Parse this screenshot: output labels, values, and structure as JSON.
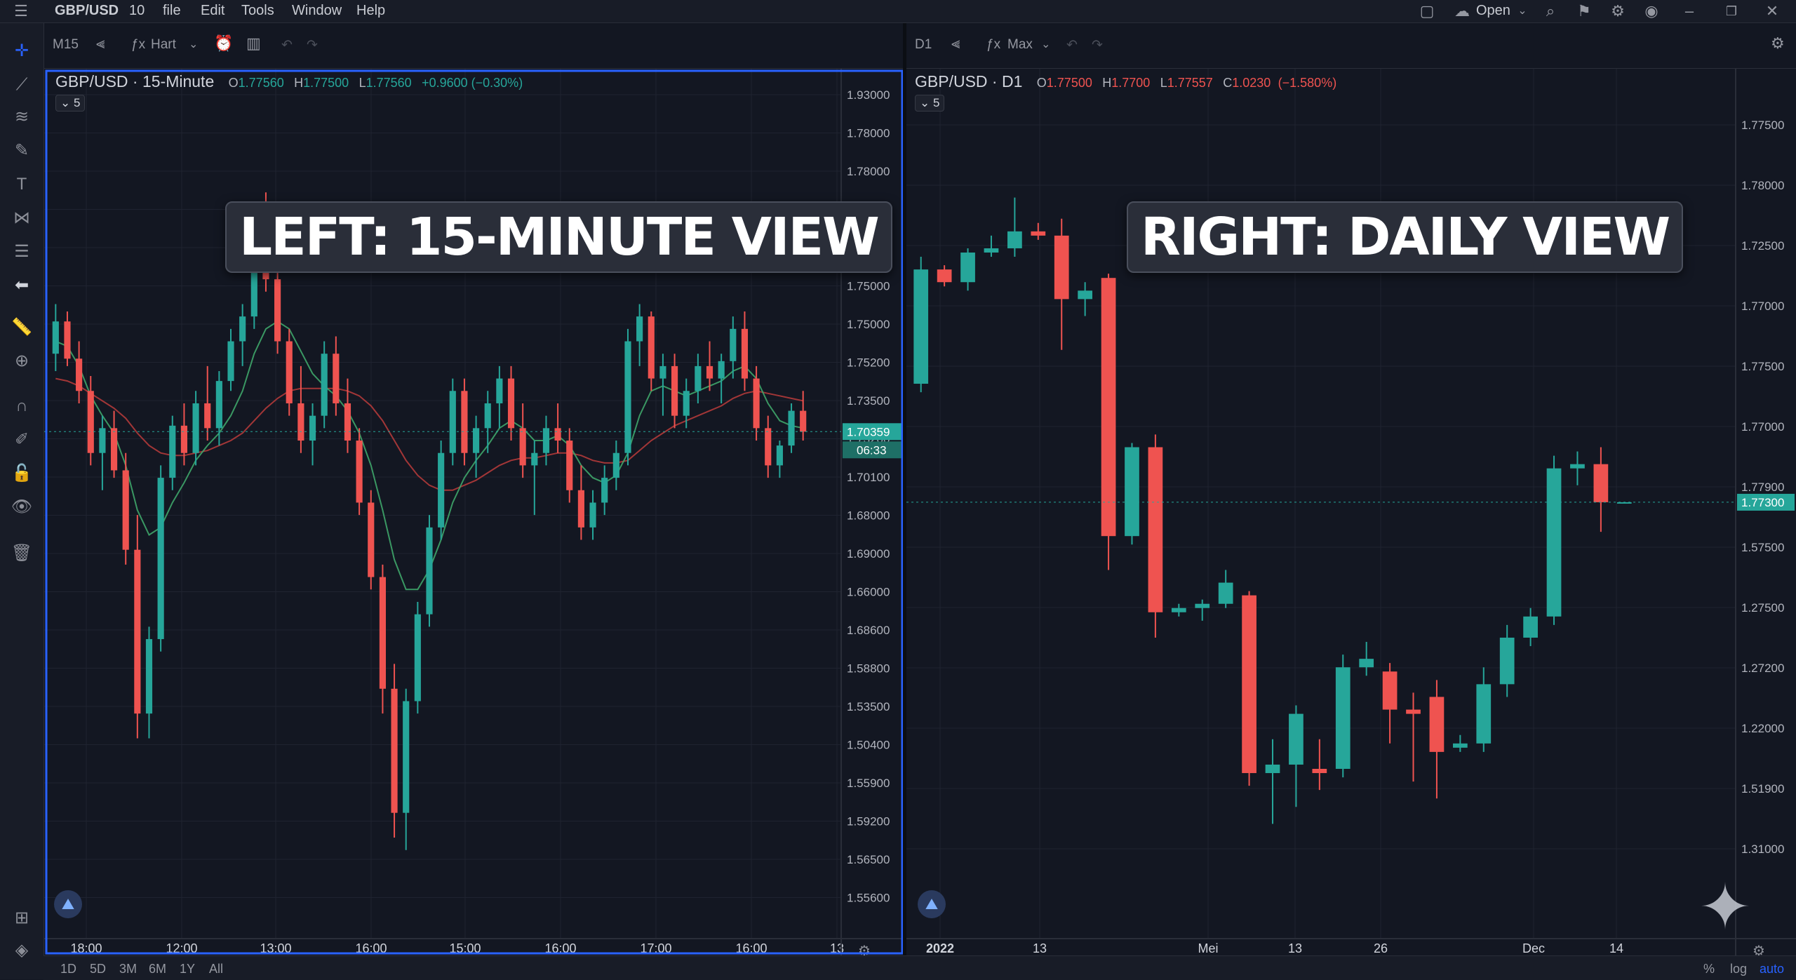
{
  "topbar": {
    "symbol": "GBP/USD",
    "interval": "10",
    "menu": [
      "file",
      "Edit",
      "Tools",
      "Window",
      "Help"
    ],
    "open_label": "Open"
  },
  "left_pane": {
    "interval_label": "M15",
    "indicator_label": "Hart",
    "legend": {
      "title": "GBP/USD · 15-Minute",
      "o": "1.77560",
      "h": "1.77500",
      "l": "1.77560",
      "change": "+0.9600 (−0.30%)"
    },
    "indicator_count": "5",
    "overlay": "LEFT: 15-MINUTE VIEW",
    "price_tag": "1.70359",
    "countdown": "06:33",
    "x_labels": [
      "18:00",
      "12:00",
      "13:00",
      "16:00",
      "15:00",
      "16:00",
      "17:00",
      "16:00",
      "13"
    ]
  },
  "right_pane": {
    "interval_label": "D1",
    "indicator_label": "Max",
    "legend": {
      "title": "GBP/USD · D1",
      "o": "1.77500",
      "h": "1.7700",
      "l": "1.77557",
      "c": "1.0230",
      "change": "(−1.580%)"
    },
    "indicator_count": "5",
    "overlay": "RIGHT: DAILY VIEW",
    "price_tag": "1.77300",
    "x_labels": [
      "2022",
      "13",
      "Mei",
      "13",
      "26",
      "Dec",
      "14"
    ]
  },
  "bottom": {
    "ranges": [
      "1D",
      "5D",
      "3M",
      "6M",
      "1Y",
      "All"
    ],
    "percent": "%",
    "log": "log",
    "auto": "auto"
  },
  "chart_data": [
    {
      "type": "candlestick",
      "title": "GBP/USD · 15-Minute",
      "y_tick_labels": [
        "1.93000",
        "1.78000",
        "1.78000",
        "1.77000",
        "1.76000",
        "1.75000",
        "1.75000",
        "1.75200",
        "1.73500",
        "1.73200",
        "1.70100",
        "1.68000",
        "1.69000",
        "1.66000",
        "1.68600",
        "1.58800",
        "1.53500",
        "1.50400",
        "1.55900",
        "1.59200",
        "1.56500",
        "1.55600"
      ],
      "x_tick_labels": [
        "18:00",
        "12:00",
        "13:00",
        "16:00",
        "15:00",
        "16:00",
        "17:00",
        "16:00",
        "13"
      ],
      "last_price": "1.70359",
      "colors": {
        "up": "#26a69a",
        "down": "#ef5350",
        "ma_fast": "#3fa66a",
        "ma_slow": "#b23a3a"
      },
      "candles": [
        [
          1.735,
          1.755,
          1.728,
          1.748
        ],
        [
          1.748,
          1.752,
          1.73,
          1.733
        ],
        [
          1.733,
          1.74,
          1.715,
          1.72
        ],
        [
          1.72,
          1.726,
          1.69,
          1.695
        ],
        [
          1.695,
          1.71,
          1.68,
          1.705
        ],
        [
          1.705,
          1.712,
          1.685,
          1.688
        ],
        [
          1.688,
          1.695,
          1.65,
          1.656
        ],
        [
          1.656,
          1.67,
          1.58,
          1.59
        ],
        [
          1.59,
          1.625,
          1.58,
          1.62
        ],
        [
          1.62,
          1.69,
          1.615,
          1.685
        ],
        [
          1.685,
          1.71,
          1.68,
          1.706
        ],
        [
          1.706,
          1.715,
          1.69,
          1.695
        ],
        [
          1.695,
          1.72,
          1.69,
          1.715
        ],
        [
          1.715,
          1.73,
          1.7,
          1.705
        ],
        [
          1.705,
          1.728,
          1.698,
          1.724
        ],
        [
          1.724,
          1.745,
          1.72,
          1.74
        ],
        [
          1.74,
          1.755,
          1.73,
          1.75
        ],
        [
          1.75,
          1.795,
          1.745,
          1.79
        ],
        [
          1.79,
          1.8,
          1.76,
          1.765
        ],
        [
          1.765,
          1.77,
          1.735,
          1.74
        ],
        [
          1.74,
          1.745,
          1.71,
          1.715
        ],
        [
          1.715,
          1.73,
          1.695,
          1.7
        ],
        [
          1.7,
          1.715,
          1.69,
          1.71
        ],
        [
          1.71,
          1.74,
          1.705,
          1.735
        ],
        [
          1.735,
          1.742,
          1.71,
          1.715
        ],
        [
          1.715,
          1.725,
          1.695,
          1.7
        ],
        [
          1.7,
          1.705,
          1.67,
          1.675
        ],
        [
          1.675,
          1.68,
          1.64,
          1.645
        ],
        [
          1.645,
          1.65,
          1.59,
          1.6
        ],
        [
          1.6,
          1.61,
          1.54,
          1.55
        ],
        [
          1.55,
          1.6,
          1.535,
          1.595
        ],
        [
          1.595,
          1.635,
          1.59,
          1.63
        ],
        [
          1.63,
          1.67,
          1.625,
          1.665
        ],
        [
          1.665,
          1.7,
          1.66,
          1.695
        ],
        [
          1.695,
          1.725,
          1.69,
          1.72
        ],
        [
          1.72,
          1.725,
          1.69,
          1.695
        ],
        [
          1.695,
          1.71,
          1.685,
          1.705
        ],
        [
          1.705,
          1.72,
          1.695,
          1.715
        ],
        [
          1.715,
          1.73,
          1.705,
          1.725
        ],
        [
          1.725,
          1.73,
          1.7,
          1.705
        ],
        [
          1.705,
          1.715,
          1.685,
          1.69
        ],
        [
          1.69,
          1.7,
          1.67,
          1.695
        ],
        [
          1.695,
          1.71,
          1.69,
          1.705
        ],
        [
          1.705,
          1.715,
          1.695,
          1.7
        ],
        [
          1.7,
          1.705,
          1.675,
          1.68
        ],
        [
          1.68,
          1.69,
          1.66,
          1.665
        ],
        [
          1.665,
          1.68,
          1.66,
          1.675
        ],
        [
          1.675,
          1.69,
          1.67,
          1.685
        ],
        [
          1.685,
          1.7,
          1.68,
          1.695
        ],
        [
          1.695,
          1.745,
          1.69,
          1.74
        ],
        [
          1.74,
          1.755,
          1.73,
          1.75
        ],
        [
          1.75,
          1.752,
          1.72,
          1.725
        ],
        [
          1.725,
          1.735,
          1.71,
          1.73
        ],
        [
          1.73,
          1.735,
          1.705,
          1.71
        ],
        [
          1.71,
          1.725,
          1.705,
          1.72
        ],
        [
          1.72,
          1.735,
          1.715,
          1.73
        ],
        [
          1.73,
          1.74,
          1.72,
          1.725
        ],
        [
          1.725,
          1.735,
          1.715,
          1.732
        ],
        [
          1.732,
          1.75,
          1.725,
          1.745
        ],
        [
          1.745,
          1.752,
          1.72,
          1.725
        ],
        [
          1.725,
          1.73,
          1.7,
          1.705
        ],
        [
          1.705,
          1.71,
          1.685,
          1.69
        ],
        [
          1.69,
          1.7,
          1.685,
          1.698
        ],
        [
          1.698,
          1.715,
          1.695,
          1.712
        ],
        [
          1.712,
          1.72,
          1.7,
          1.7036
        ]
      ],
      "ma_fast": [
        1.74,
        1.738,
        1.73,
        1.718,
        1.71,
        1.703,
        1.69,
        1.672,
        1.662,
        1.665,
        1.675,
        1.683,
        1.692,
        1.698,
        1.703,
        1.71,
        1.72,
        1.735,
        1.745,
        1.748,
        1.745,
        1.736,
        1.727,
        1.722,
        1.718,
        1.712,
        1.703,
        1.69,
        1.672,
        1.652,
        1.64,
        1.64,
        1.648,
        1.66,
        1.675,
        1.685,
        1.692,
        1.698,
        1.705,
        1.708,
        1.705,
        1.7,
        1.7,
        1.702,
        1.698,
        1.69,
        1.685,
        1.683,
        1.686,
        1.695,
        1.71,
        1.72,
        1.722,
        1.72,
        1.718,
        1.72,
        1.722,
        1.724,
        1.728,
        1.73,
        1.725,
        1.715,
        1.708,
        1.706,
        1.705
      ],
      "ma_slow": [
        1.725,
        1.724,
        1.722,
        1.719,
        1.716,
        1.713,
        1.709,
        1.703,
        1.698,
        1.695,
        1.694,
        1.694,
        1.695,
        1.696,
        1.698,
        1.7,
        1.703,
        1.708,
        1.713,
        1.717,
        1.72,
        1.721,
        1.721,
        1.721,
        1.721,
        1.72,
        1.718,
        1.714,
        1.708,
        1.7,
        1.692,
        1.686,
        1.682,
        1.68,
        1.68,
        1.682,
        1.684,
        1.687,
        1.69,
        1.692,
        1.693,
        1.693,
        1.694,
        1.695,
        1.695,
        1.694,
        1.692,
        1.691,
        1.691,
        1.692,
        1.696,
        1.7,
        1.703,
        1.706,
        1.708,
        1.71,
        1.712,
        1.714,
        1.717,
        1.719,
        1.72,
        1.719,
        1.718,
        1.717,
        1.716
      ]
    },
    {
      "type": "candlestick",
      "title": "GBP/USD · D1",
      "y_tick_labels": [
        "1.77500",
        "1.78000",
        "1.72500",
        "1.77000",
        "1.77500",
        "1.77000",
        "1.77900",
        "1.57500",
        "1.27500",
        "1.27200",
        "1.22000",
        "1.51900",
        "1.31000"
      ],
      "x_tick_labels": [
        "2022",
        "13",
        "Mei",
        "13",
        "26",
        "Dec",
        "14"
      ],
      "last_price": "1.77300",
      "colors": {
        "up": "#26a69a",
        "down": "#ef5350"
      },
      "candles": [
        [
          1.64,
          1.79,
          1.63,
          1.775
        ],
        [
          1.775,
          1.78,
          1.755,
          1.76
        ],
        [
          1.76,
          1.8,
          1.75,
          1.795
        ],
        [
          1.795,
          1.815,
          1.79,
          1.8
        ],
        [
          1.8,
          1.86,
          1.79,
          1.82
        ],
        [
          1.82,
          1.83,
          1.81,
          1.815
        ],
        [
          1.815,
          1.835,
          1.68,
          1.74
        ],
        [
          1.74,
          1.76,
          1.72,
          1.75
        ],
        [
          1.765,
          1.77,
          1.42,
          1.46
        ],
        [
          1.46,
          1.57,
          1.45,
          1.565
        ],
        [
          1.565,
          1.58,
          1.34,
          1.37
        ],
        [
          1.37,
          1.38,
          1.365,
          1.375
        ],
        [
          1.375,
          1.385,
          1.36,
          1.38
        ],
        [
          1.38,
          1.42,
          1.375,
          1.405
        ],
        [
          1.39,
          1.395,
          1.165,
          1.18
        ],
        [
          1.18,
          1.22,
          1.12,
          1.19
        ],
        [
          1.19,
          1.26,
          1.14,
          1.25
        ],
        [
          1.185,
          1.22,
          1.16,
          1.18
        ],
        [
          1.185,
          1.32,
          1.175,
          1.305
        ],
        [
          1.305,
          1.335,
          1.295,
          1.315
        ],
        [
          1.3,
          1.31,
          1.215,
          1.255
        ],
        [
          1.255,
          1.275,
          1.17,
          1.25
        ],
        [
          1.27,
          1.29,
          1.15,
          1.205
        ],
        [
          1.21,
          1.225,
          1.205,
          1.215
        ],
        [
          1.215,
          1.305,
          1.205,
          1.285
        ],
        [
          1.285,
          1.355,
          1.27,
          1.34
        ],
        [
          1.34,
          1.375,
          1.33,
          1.365
        ],
        [
          1.365,
          1.555,
          1.355,
          1.54
        ],
        [
          1.54,
          1.56,
          1.52,
          1.545
        ],
        [
          1.545,
          1.565,
          1.465,
          1.5
        ],
        [
          1.5,
          1.5,
          1.5,
          1.5
        ]
      ]
    }
  ]
}
